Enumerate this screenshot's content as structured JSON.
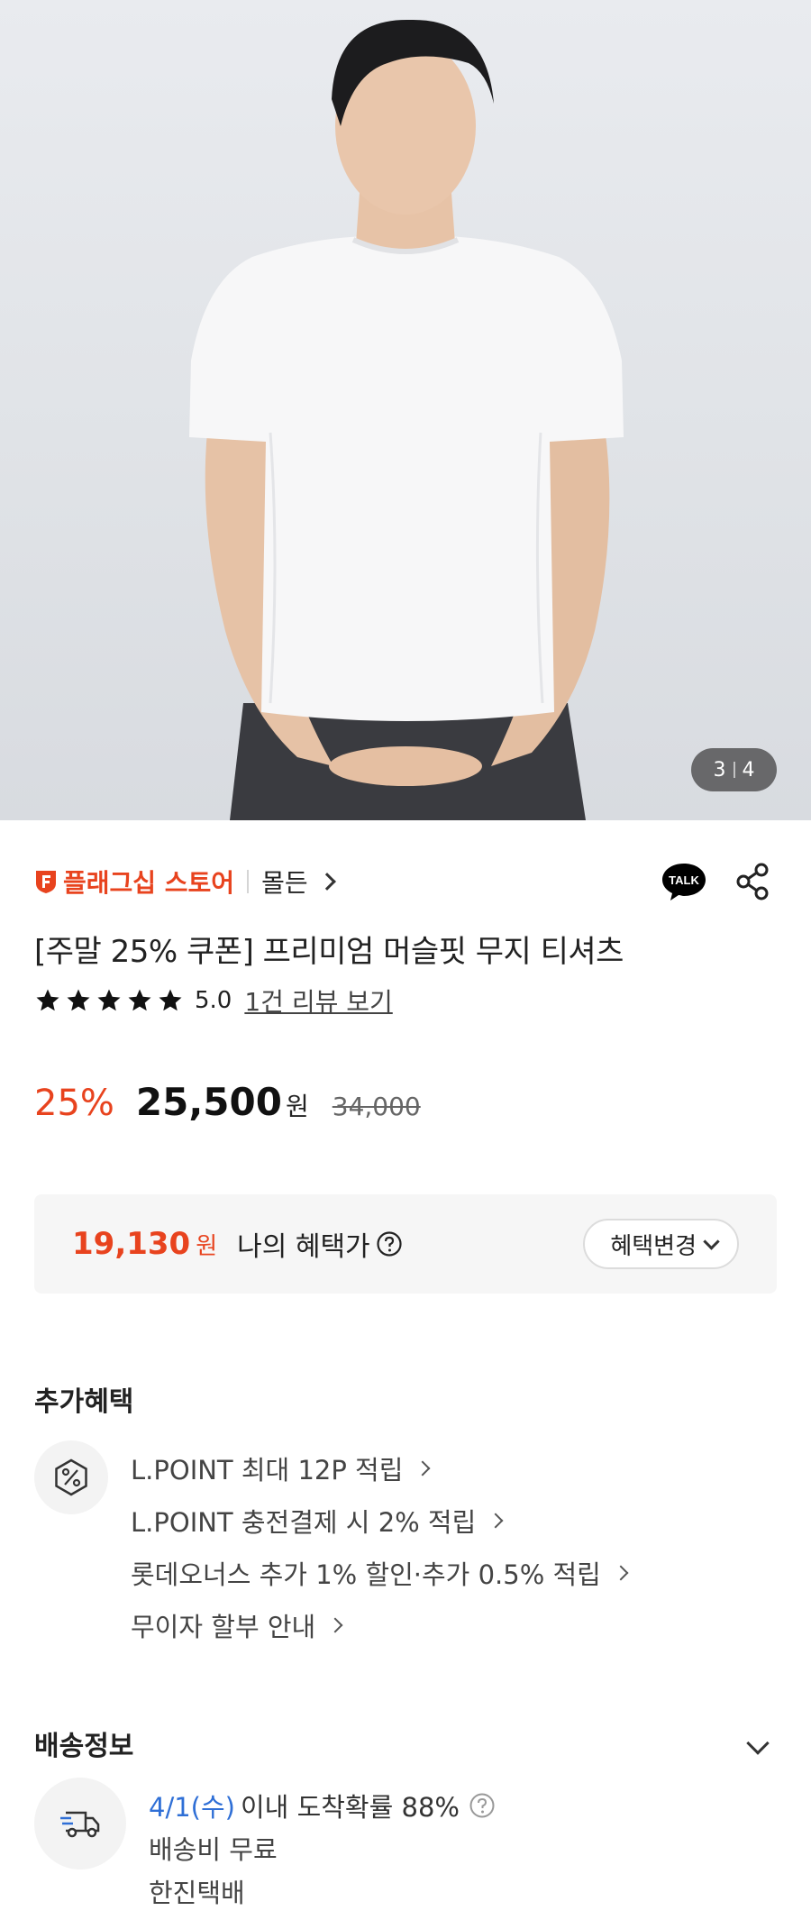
{
  "gallery": {
    "current": "3",
    "total": "4"
  },
  "store": {
    "badge": "플래그십 스토어",
    "brand": "몰든"
  },
  "product": {
    "title": "[주말 25% 쿠폰] 프리미엄 머슬핏 무지 티셔츠",
    "rating": "5.0",
    "rating_stars": 5,
    "review_link": "1건 리뷰 보기"
  },
  "price": {
    "discount": "25%",
    "sale": "25,500",
    "unit": "원",
    "original": "34,000"
  },
  "benefit": {
    "price": "19,130",
    "unit": "원",
    "label": "나의 혜택가",
    "change_button": "혜택변경"
  },
  "extra": {
    "title": "추가혜택",
    "items": [
      "L.POINT 최대 12P 적립",
      "L.POINT 충전결제 시 2% 적립",
      "롯데오너스 추가 1% 할인·추가 0.5% 적립",
      "무이자 할부 안내"
    ]
  },
  "shipping": {
    "title": "배송정보",
    "date": "4/1(수)",
    "arrival": "이내 도착확률 88%",
    "fee": "배송비 무료",
    "carrier": "한진택배"
  },
  "colors": {
    "accent": "#e8431e",
    "link_blue": "#2f6fd6",
    "talk_bg": "#000000"
  }
}
